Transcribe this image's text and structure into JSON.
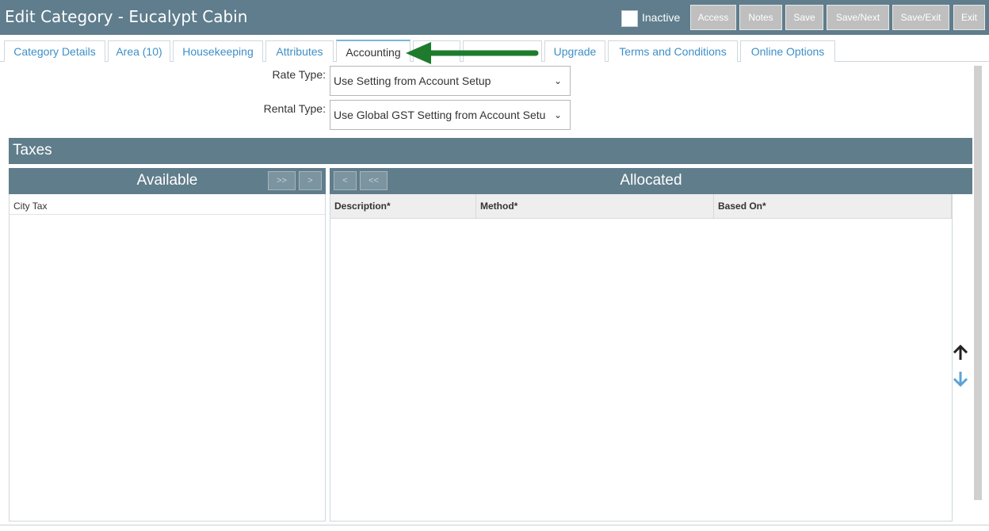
{
  "header": {
    "title": "Edit Category - Eucalypt Cabin",
    "inactive_label": "Inactive",
    "buttons": [
      "Access",
      "Notes",
      "Save",
      "Save/Next",
      "Save/Exit",
      "Exit"
    ]
  },
  "tabs": [
    {
      "label": "Category Details",
      "active": false
    },
    {
      "label": "Area (10)",
      "active": false
    },
    {
      "label": "Housekeeping",
      "active": false
    },
    {
      "label": "Attributes",
      "active": false
    },
    {
      "label": "Accounting",
      "active": true
    },
    {
      "label": "",
      "active": false
    },
    {
      "label": "",
      "active": false
    },
    {
      "label": "Upgrade",
      "active": false
    },
    {
      "label": "Terms and Conditions",
      "active": false
    },
    {
      "label": "Online Options",
      "active": false
    }
  ],
  "form": {
    "rate_type_label": "Rate Type:",
    "rate_type_value": "Use Setting from Account Setup",
    "rental_type_label": "Rental Type:",
    "rental_type_value": "Use Global GST Setting from Account Setu"
  },
  "taxes": {
    "title": "Taxes",
    "available_title": "Available",
    "available_buttons": [
      ">>",
      ">"
    ],
    "available_items": [
      "City Tax"
    ],
    "allocated_title": "Allocated",
    "allocated_buttons": [
      "<",
      "<<"
    ],
    "columns": [
      "Description*",
      "Method*",
      "Based On*"
    ]
  },
  "icons": {
    "move_up": "arrow-up-icon",
    "move_down": "arrow-down-icon",
    "pointer": "green-arrow-icon"
  },
  "colors": {
    "header_bg": "#5f7d8c",
    "section_bg": "#607d8b",
    "link": "#3d8fc9",
    "pointer_arrow": "#1e7b2e",
    "down_arrow": "#5ba3d8"
  }
}
